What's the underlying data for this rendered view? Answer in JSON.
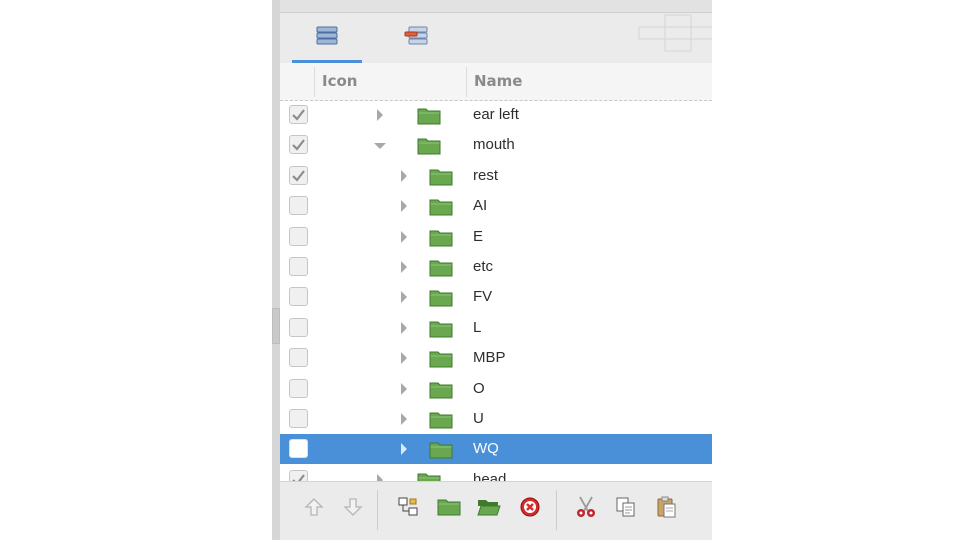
{
  "tabs": [
    {
      "name": "layers-tab",
      "icon": "layers-icon",
      "active": true
    },
    {
      "name": "layer-properties-tab",
      "icon": "layer-properties-icon",
      "active": false
    }
  ],
  "tree": {
    "columns": {
      "icon": "Icon",
      "name": "Name"
    },
    "rows": [
      {
        "label": "ear left",
        "checked": true,
        "expander": "collapsed",
        "depth": 1
      },
      {
        "label": "mouth",
        "checked": true,
        "expander": "expanded",
        "depth": 1
      },
      {
        "label": "rest",
        "checked": true,
        "expander": "collapsed",
        "depth": 2
      },
      {
        "label": "AI",
        "checked": false,
        "expander": "collapsed",
        "depth": 2
      },
      {
        "label": "E",
        "checked": false,
        "expander": "collapsed",
        "depth": 2
      },
      {
        "label": "etc",
        "checked": false,
        "expander": "collapsed",
        "depth": 2
      },
      {
        "label": "FV",
        "checked": false,
        "expander": "collapsed",
        "depth": 2
      },
      {
        "label": "L",
        "checked": false,
        "expander": "collapsed",
        "depth": 2
      },
      {
        "label": "MBP",
        "checked": false,
        "expander": "collapsed",
        "depth": 2
      },
      {
        "label": "O",
        "checked": false,
        "expander": "collapsed",
        "depth": 2
      },
      {
        "label": "U",
        "checked": false,
        "expander": "collapsed",
        "depth": 2
      },
      {
        "label": "WQ",
        "checked": false,
        "expander": "collapsed",
        "depth": 2,
        "selected": true
      },
      {
        "label": "head",
        "checked": true,
        "expander": "collapsed",
        "depth": 1
      }
    ]
  },
  "toolbar": {
    "buttons": [
      {
        "name": "raise-layer-button",
        "icon": "arrow-up-icon"
      },
      {
        "name": "lower-layer-button",
        "icon": "arrow-down-icon"
      },
      {
        "name": "encapsulate-button",
        "icon": "encapsulate-icon"
      },
      {
        "name": "new-folder-button",
        "icon": "folder-icon"
      },
      {
        "name": "open-folder-button",
        "icon": "folder-open-icon"
      },
      {
        "name": "delete-layer-button",
        "icon": "delete-icon"
      },
      {
        "name": "cut-button",
        "icon": "scissors-icon"
      },
      {
        "name": "copy-button",
        "icon": "copy-icon"
      },
      {
        "name": "paste-button",
        "icon": "paste-icon"
      }
    ]
  },
  "colors": {
    "selection": "#4a90d9",
    "folder": "#6aa84f",
    "folder_dark": "#3f7a2e",
    "delete": "#d62b2b"
  }
}
